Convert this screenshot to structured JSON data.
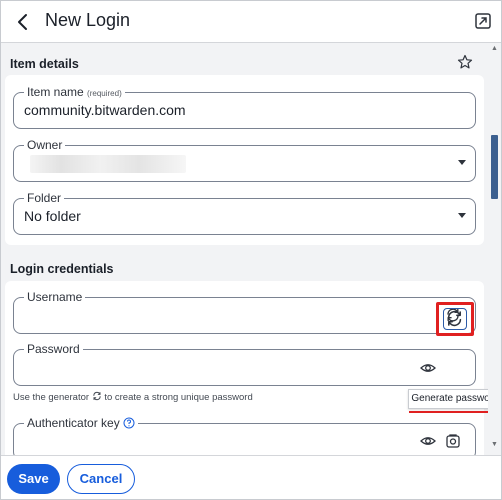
{
  "header": {
    "title": "New Login",
    "back_icon": "chevron-left-icon",
    "popout_icon": "popout-icon"
  },
  "item_details": {
    "title": "Item details",
    "favorite_icon": "star-icon",
    "item_name": {
      "label": "Item name",
      "required": "(required)",
      "value": "community.bitwarden.com"
    },
    "owner": {
      "label": "Owner",
      "value": ""
    },
    "folder": {
      "label": "Folder",
      "value": "No folder"
    }
  },
  "login_credentials": {
    "title": "Login credentials",
    "username": {
      "label": "Username",
      "value": ""
    },
    "password": {
      "label": "Password",
      "value": ""
    },
    "helper": {
      "prefix": "Use the generator",
      "suffix": "to create a strong unique password"
    },
    "authenticator": {
      "label": "Authenticator key",
      "value": ""
    }
  },
  "tooltip": "Generate password",
  "footer": {
    "save_label": "Save",
    "cancel_label": "Cancel"
  },
  "colors": {
    "primary": "#175ddc",
    "highlight": "#e02020",
    "background": "#f2f3f5"
  }
}
